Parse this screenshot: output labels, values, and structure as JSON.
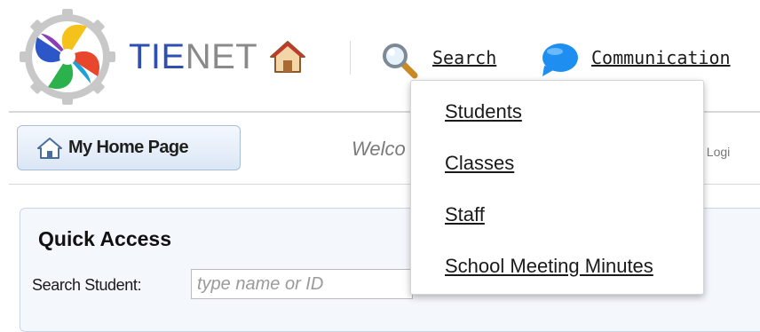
{
  "header": {
    "brand_part1": "TIE",
    "brand_part2": "NET",
    "nav": {
      "search_label": "Search",
      "communication_label": "Communication"
    }
  },
  "search_menu": {
    "items": [
      {
        "label": "Students"
      },
      {
        "label": "Classes"
      },
      {
        "label": "Staff"
      },
      {
        "label": "School Meeting Minutes"
      }
    ]
  },
  "toolbar": {
    "home_button_label": "My Home Page",
    "welcome_text": "Welco",
    "last_login_text": "t Logi"
  },
  "quick_access": {
    "title": "Quick Access",
    "search_student_label": "Search Student:",
    "search_placeholder": "type name or ID"
  },
  "colors": {
    "brand_blue": "#2f4fb3",
    "brand_gray": "#8a8a8a",
    "button_border": "#a9bedb",
    "panel_border": "#c9d6ea",
    "chat_blue": "#1e8ff0"
  },
  "icons": {
    "logo": "tienet-logo-icon",
    "home": "home-icon",
    "search": "magnifier-icon",
    "communication": "chat-bubble-icon"
  }
}
